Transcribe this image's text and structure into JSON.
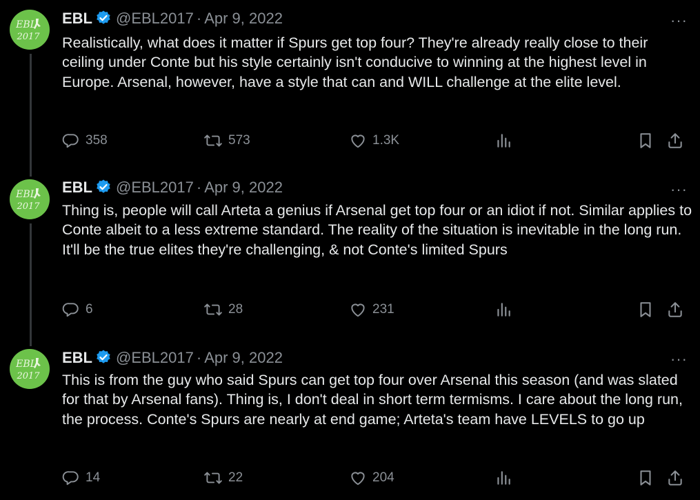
{
  "tweets": [
    {
      "author": {
        "name": "EBL",
        "handle": "@EBL2017",
        "avatar_text_top": "EBL",
        "avatar_text_bottom": "2017"
      },
      "date": "Apr 9, 2022",
      "text": "Realistically, what does it matter if Spurs get top four? They're already really close to their ceiling under Conte but his style certainly isn't conducive to winning at the highest level in Europe. Arsenal, however, have a style that can and WILL challenge at the elite level.",
      "stats": {
        "replies": "358",
        "retweets": "573",
        "likes": "1.3K"
      }
    },
    {
      "author": {
        "name": "EBL",
        "handle": "@EBL2017",
        "avatar_text_top": "EBL",
        "avatar_text_bottom": "2017"
      },
      "date": "Apr 9, 2022",
      "text": "Thing is, people will call Arteta a genius if Arsenal get top four or an idiot if not. Similar applies to Conte albeit to a less extreme standard. The reality of the situation is inevitable in the long run. It'll be the true elites they're challenging, & not Conte's limited Spurs",
      "stats": {
        "replies": "6",
        "retweets": "28",
        "likes": "231"
      }
    },
    {
      "author": {
        "name": "EBL",
        "handle": "@EBL2017",
        "avatar_text_top": "EBL",
        "avatar_text_bottom": "2017"
      },
      "date": "Apr 9, 2022",
      "text": "This is from the guy who said Spurs can get top four over Arsenal this season (and was slated for that by Arsenal fans). Thing is, I don't deal in short term termisms. I care about the long run, the process. Conte's Spurs are nearly at end game; Arteta's team have LEVELS to go up",
      "stats": {
        "replies": "14",
        "retweets": "22",
        "likes": "204"
      }
    }
  ],
  "ui": {
    "dot_separator": "·",
    "more_glyph": "···"
  },
  "colors": {
    "background": "#000000",
    "text": "#e7e9ea",
    "muted": "#8b9096",
    "verified": "#1d9bf0",
    "avatar": "#6cc24a",
    "thread_line": "#333639"
  },
  "icons": {
    "reply": "reply-icon",
    "retweet": "retweet-icon",
    "like": "heart-icon",
    "views": "analytics-icon",
    "bookmark": "bookmark-icon",
    "share": "share-icon",
    "verified": "verified-badge-icon",
    "more": "more-icon"
  }
}
